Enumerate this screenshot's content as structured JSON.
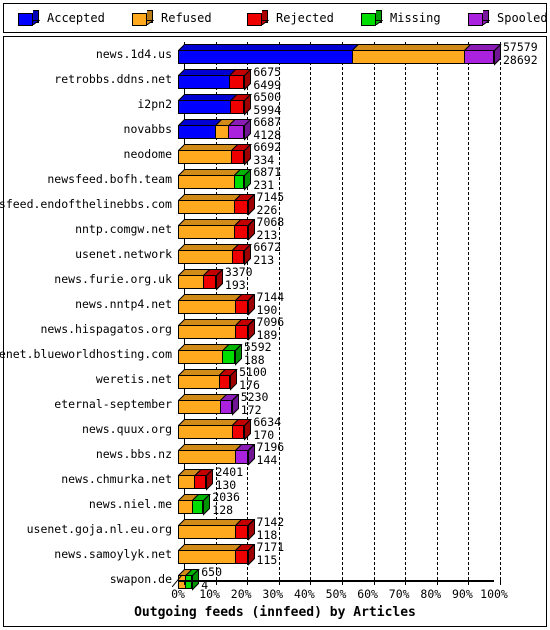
{
  "legend": {
    "items": [
      {
        "label": "Accepted",
        "color": "#0000ff",
        "icon": "cube-icon"
      },
      {
        "label": "Refused",
        "color": "#ffa91f",
        "icon": "cube-icon"
      },
      {
        "label": "Rejected",
        "color": "#ee0000",
        "icon": "cube-icon"
      },
      {
        "label": "Missing",
        "color": "#00dd00",
        "icon": "cube-icon"
      },
      {
        "label": "Spooled",
        "color": "#aa22dd",
        "icon": "cube-icon"
      }
    ]
  },
  "chart_data": {
    "type": "bar",
    "orientation": "horizontal",
    "stacked": true,
    "percent_stacked": true,
    "title": "",
    "xlabel": "Outgoing feeds (innfeed) by Articles",
    "ylabel": "",
    "xlim": [
      0,
      100
    ],
    "xticks": [
      "0%",
      "10%",
      "20%",
      "30%",
      "40%",
      "50%",
      "60%",
      "70%",
      "80%",
      "90%",
      "100%"
    ],
    "grid": true,
    "legend_position": "top",
    "series": [
      {
        "name": "Accepted",
        "color": "#0000ff"
      },
      {
        "name": "Refused",
        "color": "#ffa91f"
      },
      {
        "name": "Rejected",
        "color": "#ee0000"
      },
      {
        "name": "Missing",
        "color": "#00dd00"
      },
      {
        "name": "Spooled",
        "color": "#aa22dd"
      }
    ],
    "categories": [
      "news.1d4.us",
      "retrobbs.ddns.net",
      "i2pn2",
      "novabbs",
      "neodome",
      "newsfeed.bofh.team",
      "newsfeed.endofthelinebbs.com",
      "nntp.comgw.net",
      "usenet.network",
      "news.furie.org.uk",
      "news.nntp4.net",
      "news.hispagatos.org",
      "usenet.blueworldhosting.com",
      "weretis.net",
      "eternal-september",
      "news.quux.org",
      "news.bbs.nz",
      "news.chmurka.net",
      "news.niel.me",
      "usenet.goja.nl.eu.org",
      "news.samoylyk.net",
      "swapon.de"
    ],
    "rows": [
      {
        "label": "news.1d4.us",
        "total_width_pct": 100.0,
        "value_top": "57579",
        "value_bottom": "28692",
        "segments": [
          {
            "series": "Accepted",
            "pct": 55.0
          },
          {
            "series": "Refused",
            "pct": 35.5
          },
          {
            "series": "Spooled",
            "pct": 9.5
          }
        ]
      },
      {
        "label": "retrobbs.ddns.net",
        "total_width_pct": 21.0,
        "value_top": "6675",
        "value_bottom": "6499",
        "segments": [
          {
            "series": "Accepted",
            "pct": 77.0
          },
          {
            "series": "Rejected",
            "pct": 23.0
          }
        ]
      },
      {
        "label": "i2pn2",
        "total_width_pct": 21.0,
        "value_top": "6500",
        "value_bottom": "5994",
        "segments": [
          {
            "series": "Accepted",
            "pct": 79.0
          },
          {
            "series": "Rejected",
            "pct": 21.0
          }
        ]
      },
      {
        "label": "novabbs",
        "total_width_pct": 21.0,
        "value_top": "6687",
        "value_bottom": "4128",
        "segments": [
          {
            "series": "Accepted",
            "pct": 56.0
          },
          {
            "series": "Refused",
            "pct": 20.0
          },
          {
            "series": "Spooled",
            "pct": 24.0
          }
        ]
      },
      {
        "label": "neodome",
        "total_width_pct": 21.0,
        "value_top": "6692",
        "value_bottom": "334",
        "segments": [
          {
            "series": "Refused",
            "pct": 80.0
          },
          {
            "series": "Rejected",
            "pct": 20.0
          }
        ]
      },
      {
        "label": "newsfeed.bofh.team",
        "total_width_pct": 21.0,
        "value_top": "6871",
        "value_bottom": "231",
        "segments": [
          {
            "series": "Refused",
            "pct": 84.0
          },
          {
            "series": "Missing",
            "pct": 16.0
          }
        ]
      },
      {
        "label": "newsfeed.endofthelinebbs.com",
        "total_width_pct": 22.0,
        "value_top": "7145",
        "value_bottom": "226",
        "segments": [
          {
            "series": "Refused",
            "pct": 81.0
          },
          {
            "series": "Rejected",
            "pct": 19.0
          }
        ]
      },
      {
        "label": "nntp.comgw.net",
        "total_width_pct": 22.0,
        "value_top": "7068",
        "value_bottom": "213",
        "segments": [
          {
            "series": "Refused",
            "pct": 81.0
          },
          {
            "series": "Rejected",
            "pct": 19.0
          }
        ]
      },
      {
        "label": "usenet.network",
        "total_width_pct": 21.0,
        "value_top": "6672",
        "value_bottom": "213",
        "segments": [
          {
            "series": "Refused",
            "pct": 81.0
          },
          {
            "series": "Rejected",
            "pct": 19.0
          }
        ]
      },
      {
        "label": "news.furie.org.uk",
        "total_width_pct": 12.0,
        "value_top": "3370",
        "value_bottom": "193",
        "segments": [
          {
            "series": "Refused",
            "pct": 66.0
          },
          {
            "series": "Rejected",
            "pct": 34.0
          }
        ]
      },
      {
        "label": "news.nntp4.net",
        "total_width_pct": 22.0,
        "value_top": "7144",
        "value_bottom": "190",
        "segments": [
          {
            "series": "Refused",
            "pct": 82.0
          },
          {
            "series": "Rejected",
            "pct": 18.0
          }
        ]
      },
      {
        "label": "news.hispagatos.org",
        "total_width_pct": 22.0,
        "value_top": "7096",
        "value_bottom": "189",
        "segments": [
          {
            "series": "Refused",
            "pct": 82.0
          },
          {
            "series": "Rejected",
            "pct": 18.0
          }
        ]
      },
      {
        "label": "usenet.blueworldhosting.com",
        "total_width_pct": 18.0,
        "value_top": "5592",
        "value_bottom": "188",
        "segments": [
          {
            "series": "Refused",
            "pct": 78.0
          },
          {
            "series": "Missing",
            "pct": 22.0
          }
        ]
      },
      {
        "label": "weretis.net",
        "total_width_pct": 16.5,
        "value_top": "5100",
        "value_bottom": "176",
        "segments": [
          {
            "series": "Refused",
            "pct": 78.0
          },
          {
            "series": "Rejected",
            "pct": 22.0
          }
        ]
      },
      {
        "label": "eternal-september",
        "total_width_pct": 17.0,
        "value_top": "5230",
        "value_bottom": "172",
        "segments": [
          {
            "series": "Refused",
            "pct": 78.0
          },
          {
            "series": "Spooled",
            "pct": 22.0
          }
        ]
      },
      {
        "label": "news.quux.org",
        "total_width_pct": 21.0,
        "value_top": "6634",
        "value_bottom": "170",
        "segments": [
          {
            "series": "Refused",
            "pct": 81.0
          },
          {
            "series": "Rejected",
            "pct": 19.0
          }
        ]
      },
      {
        "label": "news.bbs.nz",
        "total_width_pct": 22.0,
        "value_top": "7196",
        "value_bottom": "144",
        "segments": [
          {
            "series": "Refused",
            "pct": 82.0
          },
          {
            "series": "Spooled",
            "pct": 18.0
          }
        ]
      },
      {
        "label": "news.chmurka.net",
        "total_width_pct": 9.0,
        "value_top": "2401",
        "value_bottom": "130",
        "segments": [
          {
            "series": "Refused",
            "pct": 58.0
          },
          {
            "series": "Rejected",
            "pct": 42.0
          }
        ]
      },
      {
        "label": "news.niel.me",
        "total_width_pct": 8.0,
        "value_top": "2036",
        "value_bottom": "128",
        "segments": [
          {
            "series": "Refused",
            "pct": 55.0
          },
          {
            "series": "Missing",
            "pct": 45.0
          }
        ]
      },
      {
        "label": "usenet.goja.nl.eu.org",
        "total_width_pct": 22.0,
        "value_top": "7142",
        "value_bottom": "118",
        "segments": [
          {
            "series": "Refused",
            "pct": 82.0
          },
          {
            "series": "Rejected",
            "pct": 18.0
          }
        ]
      },
      {
        "label": "news.samoylyk.net",
        "total_width_pct": 22.0,
        "value_top": "7171",
        "value_bottom": "115",
        "segments": [
          {
            "series": "Refused",
            "pct": 82.0
          },
          {
            "series": "Rejected",
            "pct": 18.0
          }
        ]
      },
      {
        "label": "swapon.de",
        "total_width_pct": 4.5,
        "value_top": "650",
        "value_bottom": "4",
        "segments": [
          {
            "series": "Refused",
            "pct": 52.0
          },
          {
            "series": "Missing",
            "pct": 48.0
          }
        ]
      }
    ]
  }
}
